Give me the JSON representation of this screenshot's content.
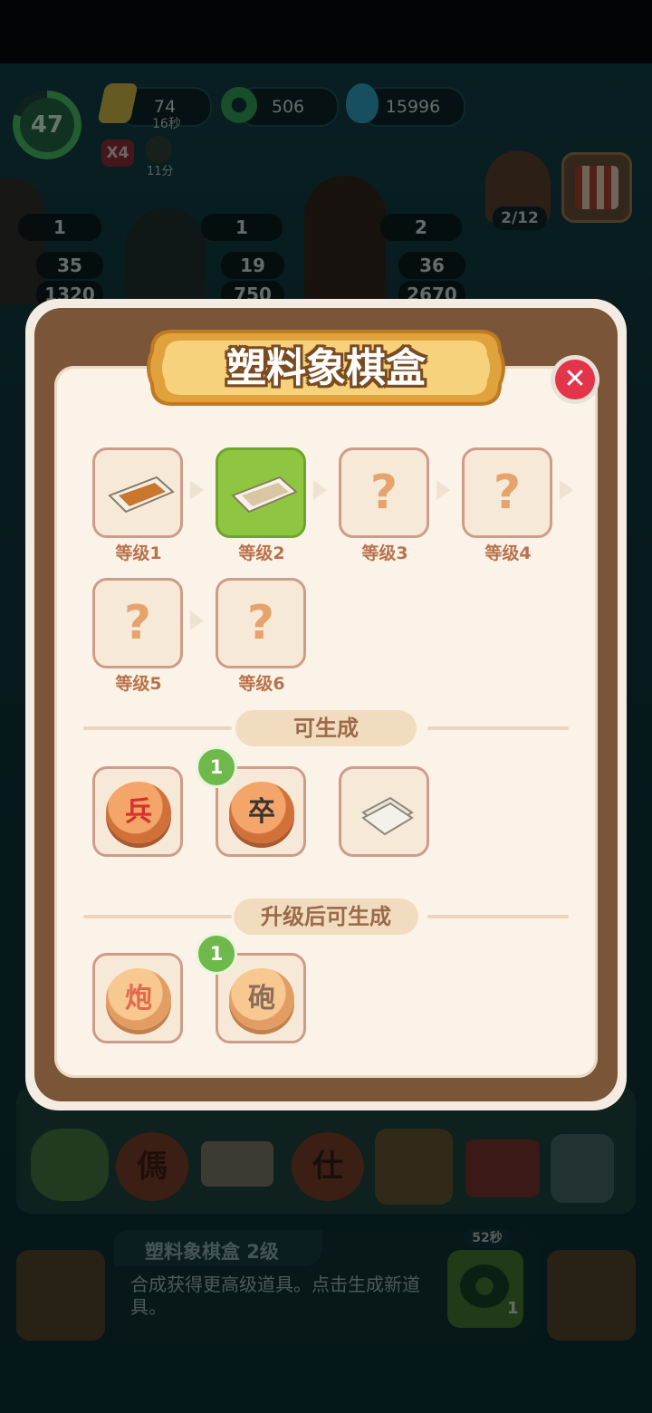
{
  "hud": {
    "level": "47",
    "energy": "74",
    "energy_timer": "16秒",
    "coins": "506",
    "gems": "15996",
    "multiplier": "X4",
    "bonus_timer": "11分",
    "orders_progress": "2/12"
  },
  "characters": [
    {
      "stars": "1",
      "hearts": "35",
      "drops": "1320"
    },
    {
      "stars": "1",
      "hearts": "19",
      "drops": "750"
    },
    {
      "stars": "2",
      "hearts": "36",
      "drops": "2670"
    }
  ],
  "modal": {
    "title": "塑料象棋盒",
    "close_symbol": "✕",
    "levels": [
      {
        "label": "等级1",
        "state": "unlocked"
      },
      {
        "label": "等级2",
        "state": "current"
      },
      {
        "label": "等级3",
        "state": "locked"
      },
      {
        "label": "等级4",
        "state": "locked"
      },
      {
        "label": "等级5",
        "state": "locked"
      },
      {
        "label": "等级6",
        "state": "locked"
      }
    ],
    "unknown_symbol": "?",
    "section_generate": "可生成",
    "generate_items": [
      {
        "glyph": "兵",
        "badge": ""
      },
      {
        "glyph": "卒",
        "badge": "1"
      },
      {
        "glyph": "",
        "badge": ""
      }
    ],
    "section_upgrade": "升级后可生成",
    "upgrade_items": [
      {
        "glyph": "炮",
        "badge": ""
      },
      {
        "glyph": "砲",
        "badge": "1"
      }
    ]
  },
  "board_row": {
    "pieces": [
      "傌",
      "仕"
    ]
  },
  "info_bar": {
    "title": "塑料象棋盒 2级",
    "description": "合成获得更高级道具。点击生成新道具。",
    "timer": "52秒",
    "coin_count": "1"
  }
}
